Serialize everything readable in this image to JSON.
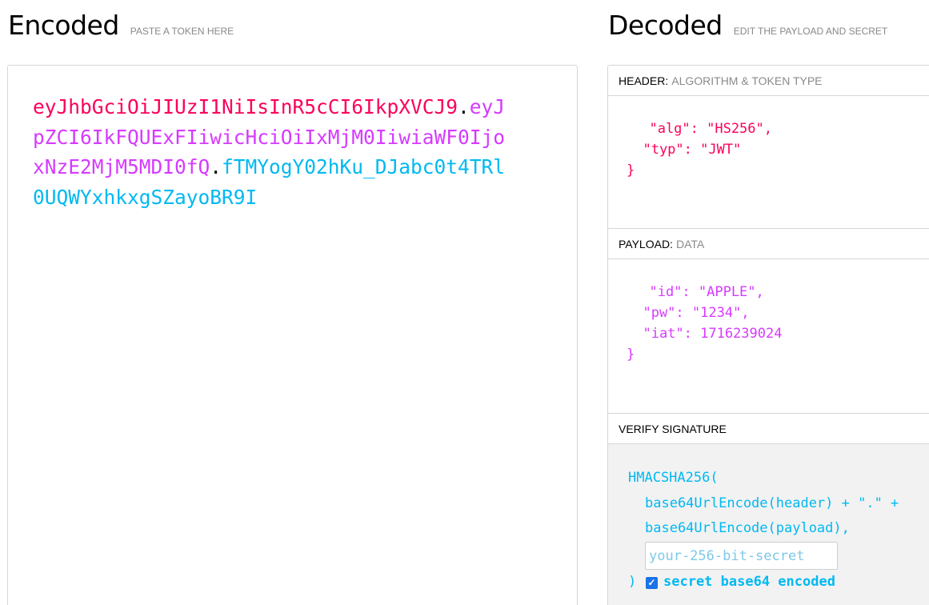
{
  "encoded": {
    "title": "Encoded",
    "subtitle": "PASTE A TOKEN HERE",
    "token_header": "eyJhbGciOiJIUzI1NiIsInR5cCI6IkpXVCJ9",
    "dot1": ".",
    "token_payload": "eyJpZCI6IkFQUExFIiwicHciOiIxMjM0IiwiaWF0IjoxNzE2MjM5MDI0fQ",
    "dot2": ".",
    "token_signature": "fTMYogY02hKu_DJabc0t4TRl0UQWYxhkxgSZayoBR9I",
    "colors": {
      "header": "#fb015b",
      "payload": "#d63aff",
      "signature": "#00b9f1",
      "dot": "#000000"
    }
  },
  "decoded": {
    "title": "Decoded",
    "subtitle": "EDIT THE PAYLOAD AND SECRET",
    "header_section": {
      "label": "HEADER:",
      "sublabel": "ALGORITHM & TOKEN TYPE",
      "json_text": "  \"alg\": \"HS256\",\n  \"typ\": \"JWT\"\n}"
    },
    "payload_section": {
      "label": "PAYLOAD:",
      "sublabel": "DATA",
      "json_text": "  \"id\": \"APPLE\",\n  \"pw\": \"1234\",\n  \"iat\": 1716239024\n}"
    },
    "verify_section": {
      "label": "VERIFY SIGNATURE",
      "line1": "HMACSHA256(",
      "line2": "base64UrlEncode(header) + \".\" +",
      "line3": "base64UrlEncode(payload),",
      "secret_placeholder": "your-256-bit-secret",
      "close_paren": ")",
      "checkbox_checked": true,
      "checkbox_label": "secret base64 encoded"
    }
  }
}
